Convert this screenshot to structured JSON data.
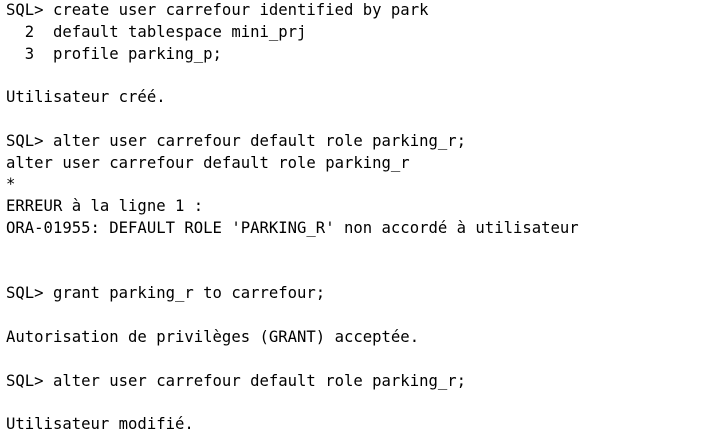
{
  "console": {
    "lines": [
      "SQL> create user carrefour identified by park",
      "  2  default tablespace mini_prj",
      "  3  profile parking_p;",
      "",
      "Utilisateur créé.",
      "",
      "SQL> alter user carrefour default role parking_r;",
      "alter user carrefour default role parking_r",
      "*",
      "ERREUR à la ligne 1 :",
      "ORA-01955: DEFAULT ROLE 'PARKING_R' non accordé à utilisateur",
      "",
      "",
      "SQL> grant parking_r to carrefour;",
      "",
      "Autorisation de privilèges (GRANT) acceptée.",
      "",
      "SQL> alter user carrefour default role parking_r;",
      "",
      "Utilisateur modifié."
    ]
  }
}
